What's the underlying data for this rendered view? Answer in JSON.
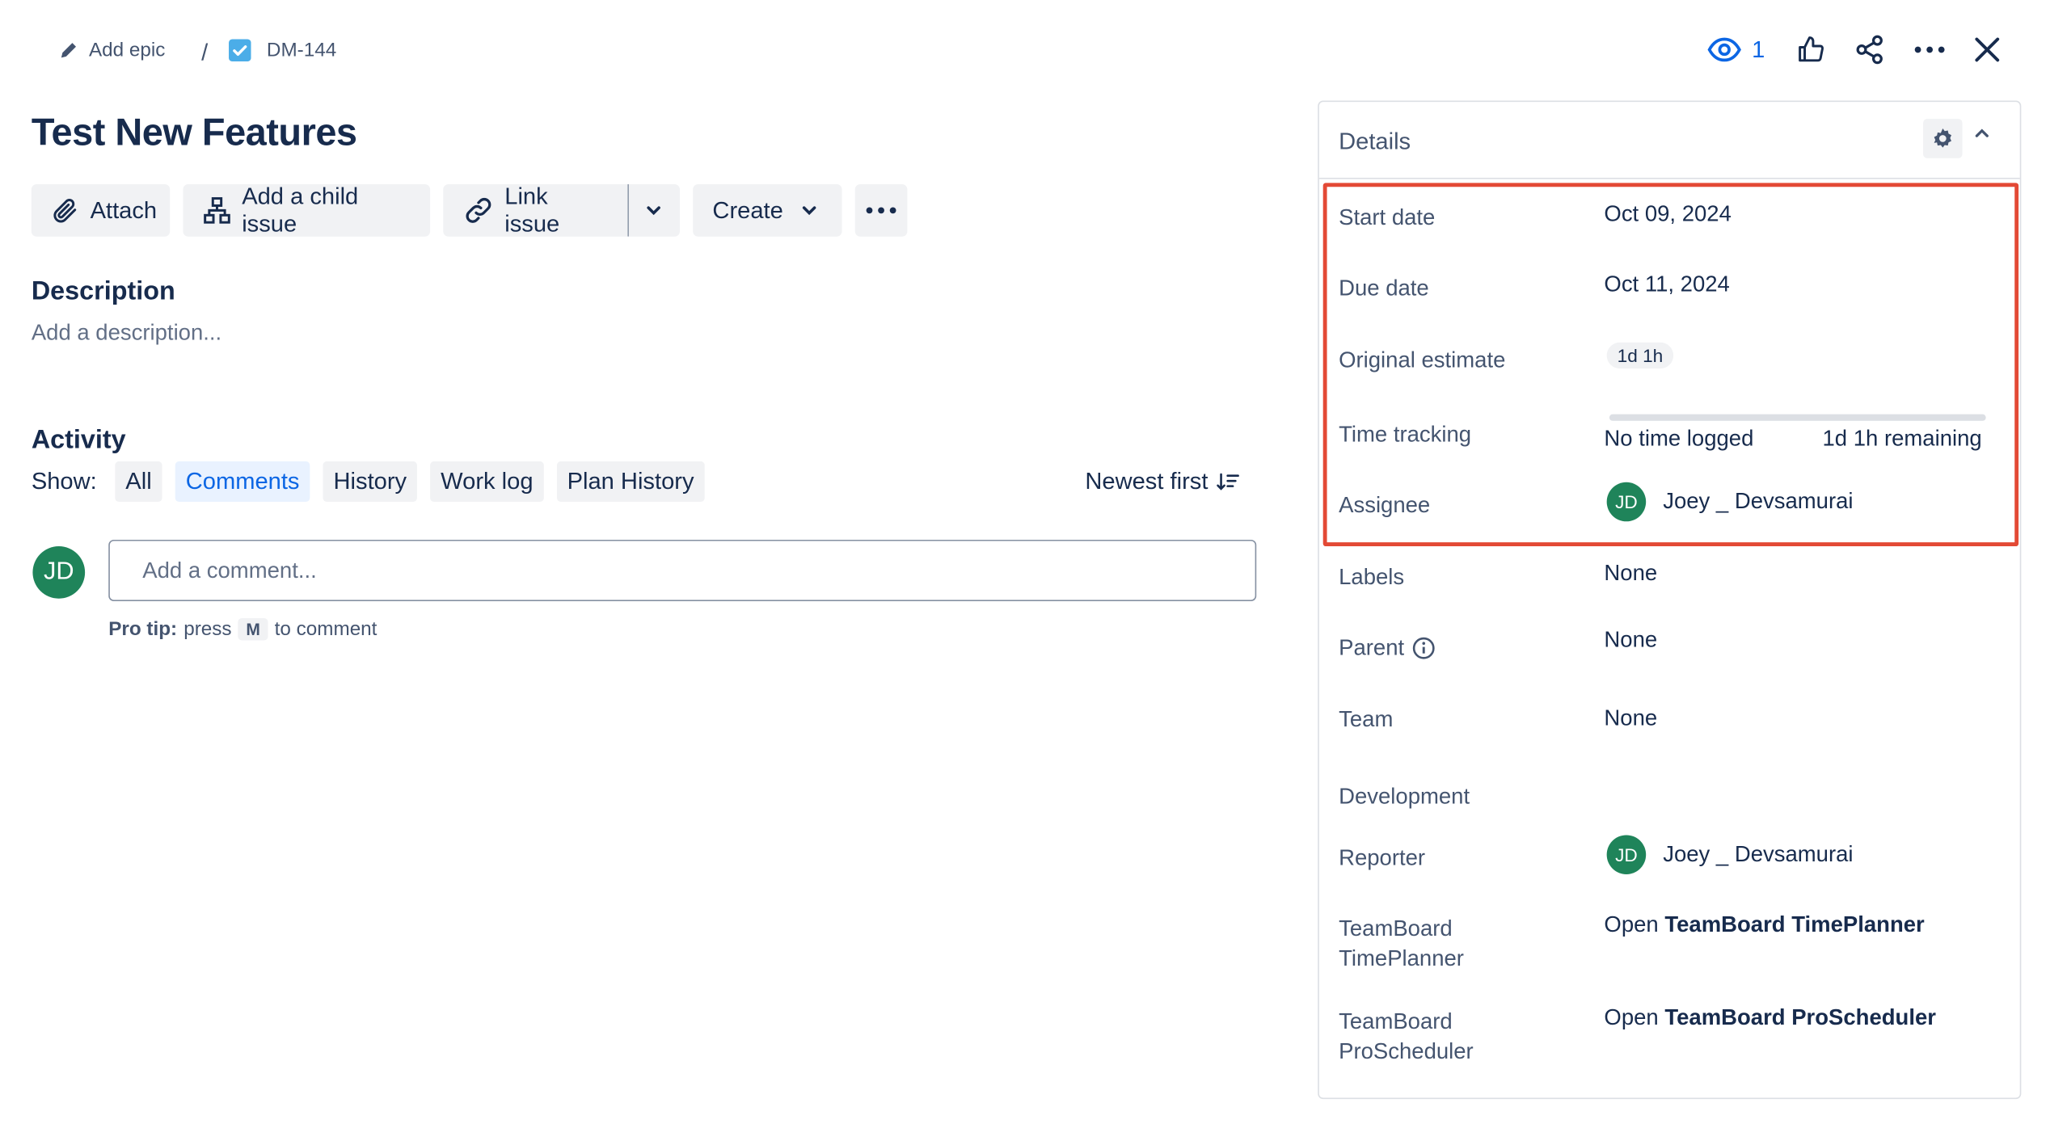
{
  "header": {
    "add_epic": "Add epic",
    "separator": "/",
    "issue_key": "DM-144",
    "watch_count": "1"
  },
  "issue": {
    "title": "Test New Features"
  },
  "toolbar": {
    "attach": "Attach",
    "add_child": "Add a child issue",
    "link_issue": "Link issue",
    "create": "Create"
  },
  "description": {
    "heading": "Description",
    "placeholder": "Add a description..."
  },
  "activity": {
    "heading": "Activity",
    "show_label": "Show:",
    "filters": [
      "All",
      "Comments",
      "History",
      "Work log",
      "Plan History"
    ],
    "active_filter": "Comments",
    "sort_label": "Newest first"
  },
  "comment": {
    "avatar_initials": "JD",
    "placeholder": "Add a comment...",
    "protip_bold": "Pro tip:",
    "protip_press": "press",
    "protip_key": "M",
    "protip_rest": "to comment"
  },
  "details": {
    "title": "Details",
    "fields": {
      "start_date": {
        "label": "Start date",
        "value": "Oct 09, 2024"
      },
      "due_date": {
        "label": "Due date",
        "value": "Oct 11, 2024"
      },
      "original_estimate": {
        "label": "Original estimate",
        "value": "1d 1h"
      },
      "time_tracking": {
        "label": "Time tracking",
        "logged": "No time logged",
        "remaining": "1d 1h remaining",
        "progress": 0
      },
      "assignee": {
        "label": "Assignee",
        "initials": "JD",
        "name": "Joey _ Devsamurai"
      },
      "labels": {
        "label": "Labels",
        "value": "None"
      },
      "parent": {
        "label": "Parent",
        "value": "None"
      },
      "team": {
        "label": "Team",
        "value": "None"
      },
      "development": {
        "label": "Development"
      },
      "reporter": {
        "label": "Reporter",
        "initials": "JD",
        "name": "Joey _ Devsamurai"
      },
      "timeplanner": {
        "label_line1": "TeamBoard",
        "label_line2": "TimePlanner",
        "prefix": "Open",
        "link": "TeamBoard TimePlanner"
      },
      "proscheduler": {
        "label_line1": "TeamBoard",
        "label_line2": "ProScheduler",
        "prefix": "Open",
        "link": "TeamBoard ProScheduler"
      }
    }
  },
  "colors": {
    "brand_blue": "#0c66e4",
    "avatar_green": "#1f845a",
    "highlight_red": "#e34935",
    "text": "#172b4d"
  }
}
